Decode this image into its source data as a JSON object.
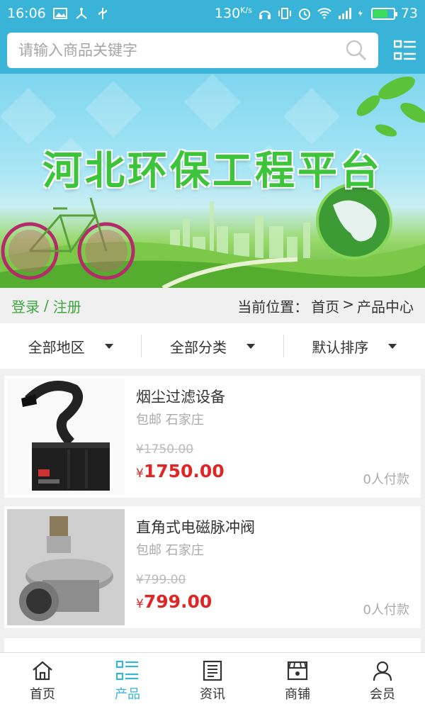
{
  "status_bar": {
    "time": "16:06",
    "speed": "130",
    "speed_unit": "K/s",
    "battery": "73",
    "colors": {
      "bar": "#39b3d7"
    }
  },
  "search": {
    "placeholder": "请输入商品关键字"
  },
  "banner": {
    "title": "河北环保工程平台"
  },
  "auth": {
    "login": "登录",
    "separator": "/",
    "register": "注册"
  },
  "breadcrumb": {
    "prefix": "当前位置：",
    "home": "首页",
    "sep": ">",
    "current": "产品中心"
  },
  "filters": [
    {
      "label": "全部地区"
    },
    {
      "label": "全部分类"
    },
    {
      "label": "默认排序"
    }
  ],
  "products": [
    {
      "name": "烟尘过滤设备",
      "tag": "包邮 石家庄",
      "old_price": "¥1750.00",
      "price_symbol": "¥",
      "price": "1750.00",
      "sold": "0人付款"
    },
    {
      "name": "直角式电磁脉冲阀",
      "tag": "包邮 石家庄",
      "old_price": "¥799.00",
      "price_symbol": "¥",
      "price": "799.00",
      "sold": "0人付款"
    }
  ],
  "nav": [
    {
      "label": "首页",
      "icon": "home-icon"
    },
    {
      "label": "产品",
      "icon": "list-icon",
      "active": true
    },
    {
      "label": "资讯",
      "icon": "news-icon"
    },
    {
      "label": "商铺",
      "icon": "store-icon"
    },
    {
      "label": "会员",
      "icon": "user-icon"
    }
  ],
  "colors": {
    "accent": "#39b3d7",
    "price": "#e02525",
    "link": "#3da53d"
  }
}
